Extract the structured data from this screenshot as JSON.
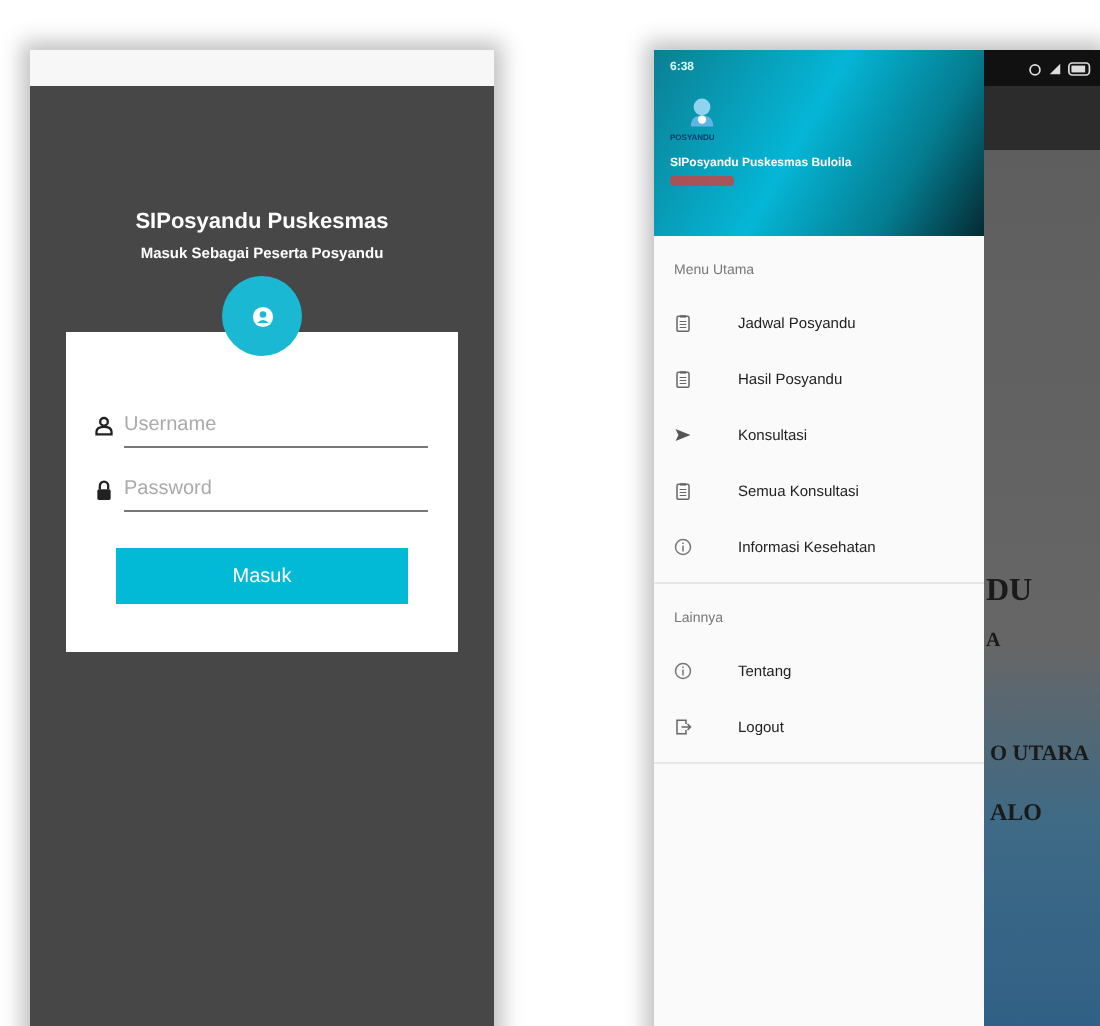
{
  "login_screen": {
    "title": "SIPosyandu Puskesmas",
    "subtitle": "Masuk Sebagai Peserta Posyandu",
    "fields": [
      {
        "kind": "user",
        "placeholder": "Username"
      },
      {
        "kind": "password",
        "placeholder": "Password"
      }
    ],
    "button": "Masuk"
  },
  "drawer_screen": {
    "status_bar": {
      "time": "6:38"
    },
    "header": {
      "logo_text": "POSYANDU",
      "title": "SIPosyandu Puskesmas Buloila"
    },
    "sections": [
      {
        "heading": "Menu Utama",
        "items": [
          {
            "kind": "clipboard",
            "label": "Jadwal Posyandu"
          },
          {
            "kind": "clipboard",
            "label": "Hasil Posyandu"
          },
          {
            "kind": "send",
            "label": "Konsultasi"
          },
          {
            "kind": "clipboard",
            "label": "Semua Konsultasi"
          },
          {
            "kind": "info",
            "label": "Informasi Kesehatan"
          }
        ]
      },
      {
        "heading": "Lainnya",
        "items": [
          {
            "kind": "info",
            "label": "Tentang"
          },
          {
            "kind": "exit",
            "label": "Logout"
          }
        ]
      }
    ],
    "background_text": [
      "DU",
      "A",
      "O UTARA",
      "ALO"
    ]
  }
}
